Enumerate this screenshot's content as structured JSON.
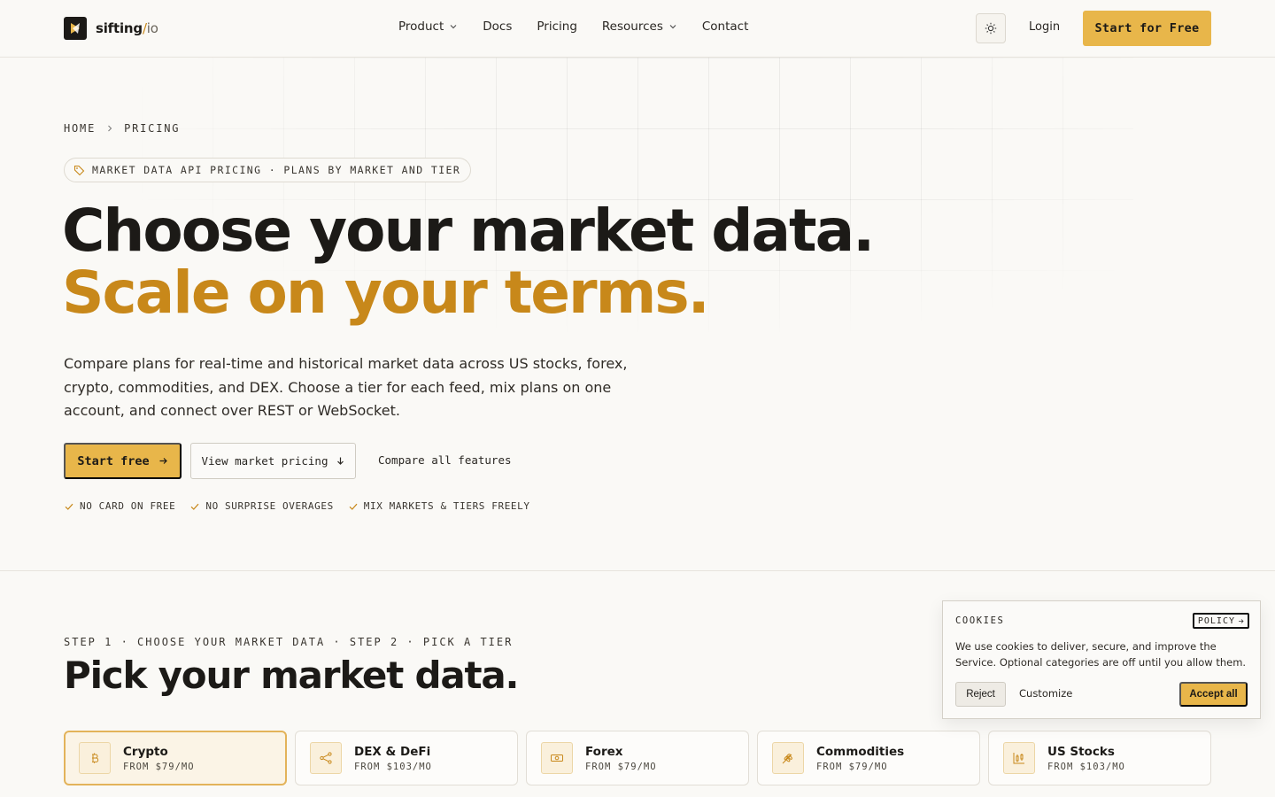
{
  "brand": {
    "name": "sifting",
    "slash": "/",
    "suffix": "io"
  },
  "nav": {
    "links": [
      {
        "label": "Product",
        "dropdown": true
      },
      {
        "label": "Docs",
        "dropdown": false
      },
      {
        "label": "Pricing",
        "dropdown": false
      },
      {
        "label": "Resources",
        "dropdown": true
      },
      {
        "label": "Contact",
        "dropdown": false
      }
    ],
    "theme_icon": "sun-icon",
    "login": "Login",
    "cta": "Start for Free"
  },
  "breadcrumb": [
    "HOME",
    "PRICING"
  ],
  "pill": {
    "icon": "tag-icon",
    "text": "MARKET DATA API PRICING · PLANS BY MARKET AND TIER"
  },
  "hero": {
    "line1": "Choose your market data.",
    "line2": "Scale on your terms.",
    "lede": "Compare plans for real-time and historical market data across US stocks, forex, crypto, commodities, and DEX. Choose a tier for each feed, mix plans on one account, and connect over REST or WebSocket.",
    "primary": "Start free",
    "secondary": "View market pricing",
    "link": "Compare all features",
    "checks": [
      "NO CARD ON FREE",
      "NO SURPRISE OVERAGES",
      "MIX MARKETS & TIERS FREELY"
    ]
  },
  "section": {
    "step": "STEP 1 · CHOOSE YOUR MARKET DATA · STEP 2 · PICK A TIER",
    "title": "Pick your market data.",
    "markets": [
      {
        "name": "Crypto",
        "price": "FROM $79/MO",
        "icon": "bitcoin-icon",
        "active": true
      },
      {
        "name": "DEX & DeFi",
        "price": "FROM $103/MO",
        "icon": "network-icon",
        "active": false
      },
      {
        "name": "Forex",
        "price": "FROM $79/MO",
        "icon": "banknote-icon",
        "active": false
      },
      {
        "name": "Commodities",
        "price": "FROM $79/MO",
        "icon": "wheat-icon",
        "active": false
      },
      {
        "name": "US Stocks",
        "price": "FROM $103/MO",
        "icon": "candlestick-icon",
        "active": false
      }
    ]
  },
  "cookie": {
    "title": "COOKIES",
    "policy": "POLICY",
    "text": "We use cookies to deliver, secure, and improve the Service. Optional categories are off until you allow them.",
    "reject": "Reject",
    "customize": "Customize",
    "accept": "Accept all"
  },
  "colors": {
    "accent": "#e8b64a",
    "accent_text": "#c8881a",
    "background": "#faf9f6"
  }
}
